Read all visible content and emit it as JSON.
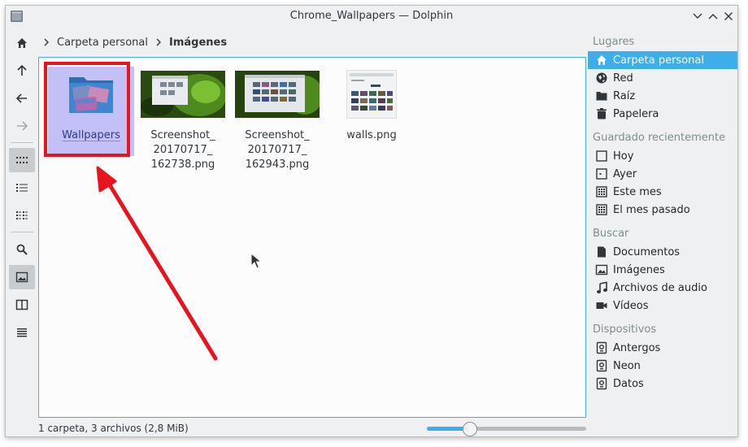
{
  "window": {
    "title": "Chrome_Wallpapers — Dolphin"
  },
  "breadcrumb": {
    "items": [
      "Carpeta personal",
      "Imágenes"
    ]
  },
  "files": [
    {
      "name": "Wallpapers",
      "type": "folder",
      "selected": true
    },
    {
      "name": "Screenshot_\n20170717_\n162738.png",
      "type": "image",
      "selected": false
    },
    {
      "name": "Screenshot_\n20170717_\n162943.png",
      "type": "image",
      "selected": false
    },
    {
      "name": "walls.png",
      "type": "image",
      "selected": false
    }
  ],
  "status": {
    "summary": "1 carpeta, 3 archivos (2,8 MiB)",
    "zoom_fraction": 0.27
  },
  "places": {
    "sections": [
      {
        "title": "Lugares",
        "items": [
          {
            "label": "Carpeta personal",
            "icon": "home-icon",
            "active": true
          },
          {
            "label": "Red",
            "icon": "network-globe-icon",
            "active": false
          },
          {
            "label": "Raíz",
            "icon": "folder-icon",
            "active": false
          },
          {
            "label": "Papelera",
            "icon": "trash-icon",
            "active": false
          }
        ]
      },
      {
        "title": "Guardado recientemente",
        "items": [
          {
            "label": "Hoy",
            "icon": "calendar-today-icon",
            "active": false
          },
          {
            "label": "Ayer",
            "icon": "calendar-yesterday-icon",
            "active": false
          },
          {
            "label": "Este mes",
            "icon": "calendar-month-icon",
            "active": false
          },
          {
            "label": "El mes pasado",
            "icon": "calendar-month-icon",
            "active": false
          }
        ]
      },
      {
        "title": "Buscar",
        "items": [
          {
            "label": "Documentos",
            "icon": "document-icon",
            "active": false
          },
          {
            "label": "Imágenes",
            "icon": "image-icon",
            "active": false
          },
          {
            "label": "Archivos de audio",
            "icon": "music-note-icon",
            "active": false
          },
          {
            "label": "Vídeos",
            "icon": "video-camera-icon",
            "active": false
          }
        ]
      },
      {
        "title": "Dispositivos",
        "items": [
          {
            "label": "Antergos",
            "icon": "drive-icon",
            "active": false
          },
          {
            "label": "Neon",
            "icon": "drive-icon",
            "active": false
          },
          {
            "label": "Datos",
            "icon": "drive-icon",
            "active": false
          }
        ]
      }
    ]
  },
  "colors": {
    "accent": "#3daee9",
    "selection": "#c2c0f7",
    "annotation_red": "#e8141d",
    "window_bg": "#eff0f1",
    "view_bg": "#fcfcfc"
  }
}
